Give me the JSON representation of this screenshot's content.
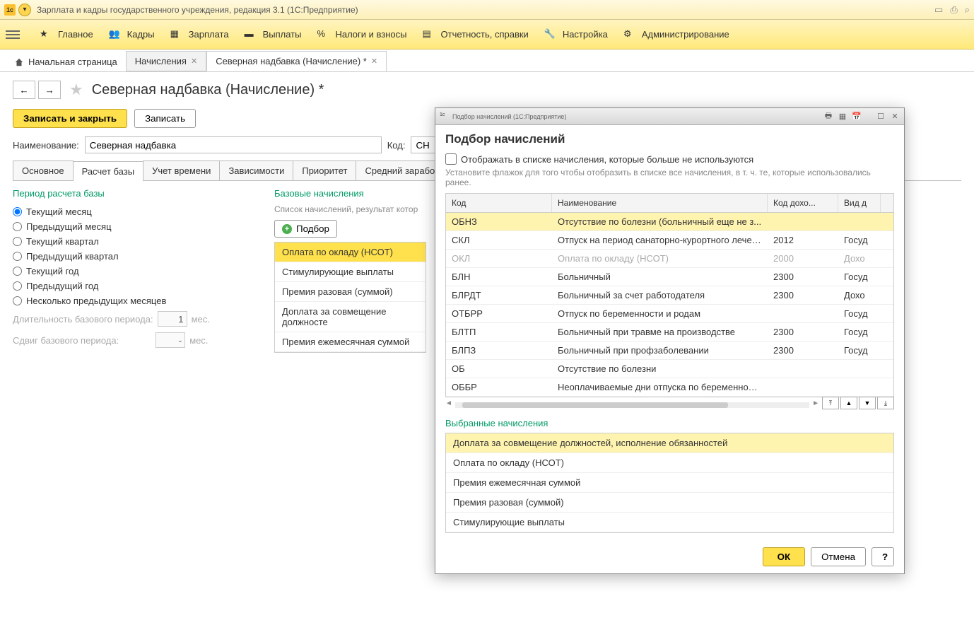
{
  "window": {
    "title": "Зарплата и кадры государственного учреждения, редакция 3.1  (1С:Предприятие)"
  },
  "menu": {
    "items": [
      "Главное",
      "Кадры",
      "Зарплата",
      "Выплаты",
      "Налоги и взносы",
      "Отчетность, справки",
      "Настройка",
      "Администрирование"
    ]
  },
  "tabs": {
    "home": "Начальная страница",
    "items": [
      {
        "label": "Начисления"
      },
      {
        "label": "Северная надбавка (Начисление) *"
      }
    ]
  },
  "page": {
    "title": "Северная надбавка (Начисление) *",
    "btn_save_close": "Записать и закрыть",
    "btn_save": "Записать",
    "label_name": "Наименование:",
    "value_name": "Северная надбавка",
    "label_code": "Код:",
    "value_code": "СН"
  },
  "subtabs": [
    "Основное",
    "Расчет базы",
    "Учет времени",
    "Зависимости",
    "Приоритет",
    "Средний заработок"
  ],
  "period": {
    "title": "Период расчета базы",
    "options": [
      "Текущий месяц",
      "Предыдущий месяц",
      "Текущий квартал",
      "Предыдущий квартал",
      "Текущий год",
      "Предыдущий год",
      "Несколько предыдущих месяцев"
    ],
    "dur_label": "Длительность базового периода:",
    "dur_val": "1",
    "dur_unit": "мес.",
    "shift_label": "Сдвиг базового периода:",
    "shift_val": "-",
    "shift_unit": "мес."
  },
  "base": {
    "title": "Базовые начисления",
    "hint": "Список начислений, результат котор",
    "btn_add": "Подбор",
    "items": [
      "Оплата по окладу (НСОТ)",
      "Стимулирующие выплаты",
      "Премия разовая (суммой)",
      "Доплата за совмещение должносте",
      "Премия ежемесячная суммой"
    ]
  },
  "dialog": {
    "titlebar": "Подбор начислений  (1С:Предприятие)",
    "title": "Подбор начислений",
    "checkbox_label": "Отображать в списке начисления, которые больше не используются",
    "hint": "Установите флажок для того чтобы отобразить в списке все начисления, в т. ч. те, которые использовались ранее.",
    "headers": {
      "code": "Код",
      "name": "Наименование",
      "dohod": "Код дохо...",
      "vid": "Вид д"
    },
    "rows": [
      {
        "code": "ОБНЗ",
        "name": "Отсутствие по болезни (больничный еще не з...",
        "dohod": "",
        "vid": "",
        "sel": true
      },
      {
        "code": "СКЛ",
        "name": "Отпуск на период санаторно-курортного лечен...",
        "dohod": "2012",
        "vid": "Госуд"
      },
      {
        "code": "ОКЛ",
        "name": "Оплата по окладу (НСОТ)",
        "dohod": "2000",
        "vid": "Дохо",
        "dis": true
      },
      {
        "code": "БЛН",
        "name": "Больничный",
        "dohod": "2300",
        "vid": "Госуд"
      },
      {
        "code": "БЛРДТ",
        "name": "Больничный за счет работодателя",
        "dohod": "2300",
        "vid": "Дохо"
      },
      {
        "code": "ОТБРР",
        "name": "Отпуск по беременности и родам",
        "dohod": "",
        "vid": "Госуд"
      },
      {
        "code": "БЛТП",
        "name": "Больничный при травме на производстве",
        "dohod": "2300",
        "vid": "Госуд"
      },
      {
        "code": "БЛПЗ",
        "name": "Больничный при профзаболевании",
        "dohod": "2300",
        "vid": "Госуд"
      },
      {
        "code": "ОБ",
        "name": "Отсутствие по болезни",
        "dohod": "",
        "vid": ""
      },
      {
        "code": "ОББР",
        "name": "Неоплачиваемые дни отпуска по беременност...",
        "dohod": "",
        "vid": ""
      }
    ],
    "selected_title": "Выбранные начисления",
    "selected": [
      "Доплата за совмещение должностей, исполнение обязанностей",
      "Оплата по окладу (НСОТ)",
      "Премия ежемесячная суммой",
      "Премия разовая (суммой)",
      "Стимулирующие выплаты"
    ],
    "btn_ok": "ОК",
    "btn_cancel": "Отмена",
    "btn_help": "?"
  }
}
